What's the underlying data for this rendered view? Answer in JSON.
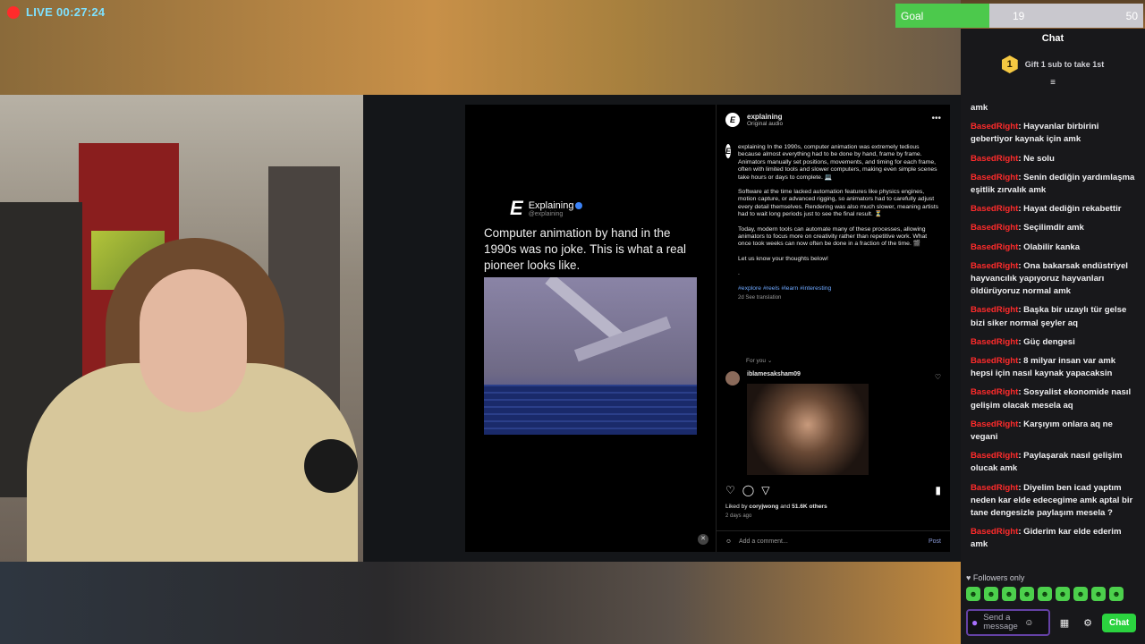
{
  "stream": {
    "live_label": "LIVE 00:27:24"
  },
  "goal": {
    "label": "Goal",
    "current": "19",
    "target": "50",
    "progress": 0.38
  },
  "screen": {
    "reel": {
      "brand": "Explaining",
      "handle": "@explaining",
      "caption": "Computer animation by hand in the 1990s was no joke. This is what a real pioneer looks like."
    },
    "post": {
      "account": "explaining",
      "audio": "Original audio",
      "paragraphs": [
        "explaining In the 1990s, computer animation was extremely tedious because almost everything had to be done by hand, frame by frame. Animators manually set positions, movements, and timing for each frame, often with limited tools and slower computers, making even simple scenes take hours or days to complete. 💻",
        "Software at the time lacked automation features like physics engines, motion capture, or advanced rigging, so animators had to carefully adjust every detail themselves. Rendering was also much slower, meaning artists had to wait long periods just to see the final result. ⏳",
        "Today, modern tools can automate many of these processes, allowing animators to focus more on creativity rather than repetitive work. What once took weeks can now often be done in a fraction of the time. 🎬",
        "Let us know your thoughts below!",
        "."
      ],
      "tags": "#explore #reels #learn #interesting",
      "meta": "2d   See translation",
      "for_you": "For you ⌄",
      "comment_user": "iblamesaksham09",
      "liked_prefix": "Liked by ",
      "liked_user": "coryjwong",
      "liked_and": " and ",
      "liked_count": "51.6K others",
      "ago": "2 days ago",
      "add_comment": "Add a comment...",
      "post_label": "Post"
    }
  },
  "chat": {
    "title": "Chat",
    "gift_rank": "1",
    "gift_text": "Gift 1 sub to take 1st",
    "messages": [
      {
        "user": "",
        "text": "amk"
      },
      {
        "user": "BasedRight",
        "text": ": Hayvanlar birbirini gebertiyor kaynak için amk"
      },
      {
        "user": "BasedRight",
        "text": ": Ne solu"
      },
      {
        "user": "BasedRight",
        "text": ": Senin dediğin yardımlaşma eşitlik zırvalık amk"
      },
      {
        "user": "BasedRight",
        "text": ": Hayat dediğin rekabettir"
      },
      {
        "user": "BasedRight",
        "text": ": Seçilimdir amk"
      },
      {
        "user": "BasedRight",
        "text": ": Olabilir kanka"
      },
      {
        "user": "BasedRight",
        "text": ": Ona bakarsak endüstriyel hayvancılık yapıyoruz hayvanları öldürüyoruz normal amk"
      },
      {
        "user": "BasedRight",
        "text": ": Başka bir uzaylı tür gelse bizi siker normal şeyler aq"
      },
      {
        "user": "BasedRight",
        "text": ": Güç dengesi"
      },
      {
        "user": "BasedRight",
        "text": ": 8 milyar insan var amk hepsi için nasıl kaynak yapacaksin"
      },
      {
        "user": "BasedRight",
        "text": ": Sosyalist ekonomide nasıl gelişim olacak mesela aq"
      },
      {
        "user": "BasedRight",
        "text": ": Karşıyım onlara aq ne vegani"
      },
      {
        "user": "BasedRight",
        "text": ": Paylaşarak nasıl gelişim olucak amk"
      },
      {
        "user": "BasedRight",
        "text": ": Diyelim ben icad yaptım neden kar elde edecegime amk aptal bir tane dengesizle paylaşım mesela ?"
      },
      {
        "user": "BasedRight",
        "text": ": Giderim kar elde ederim amk"
      }
    ],
    "followers_only": "♥ Followers only",
    "input_placeholder": "Send a message",
    "chat_button": "Chat"
  },
  "colors": {
    "goal_fill": "#4cc94c",
    "username": "#ff2b2b",
    "chat_button": "#2bd33f",
    "live_dot": "#ff2b2b"
  }
}
